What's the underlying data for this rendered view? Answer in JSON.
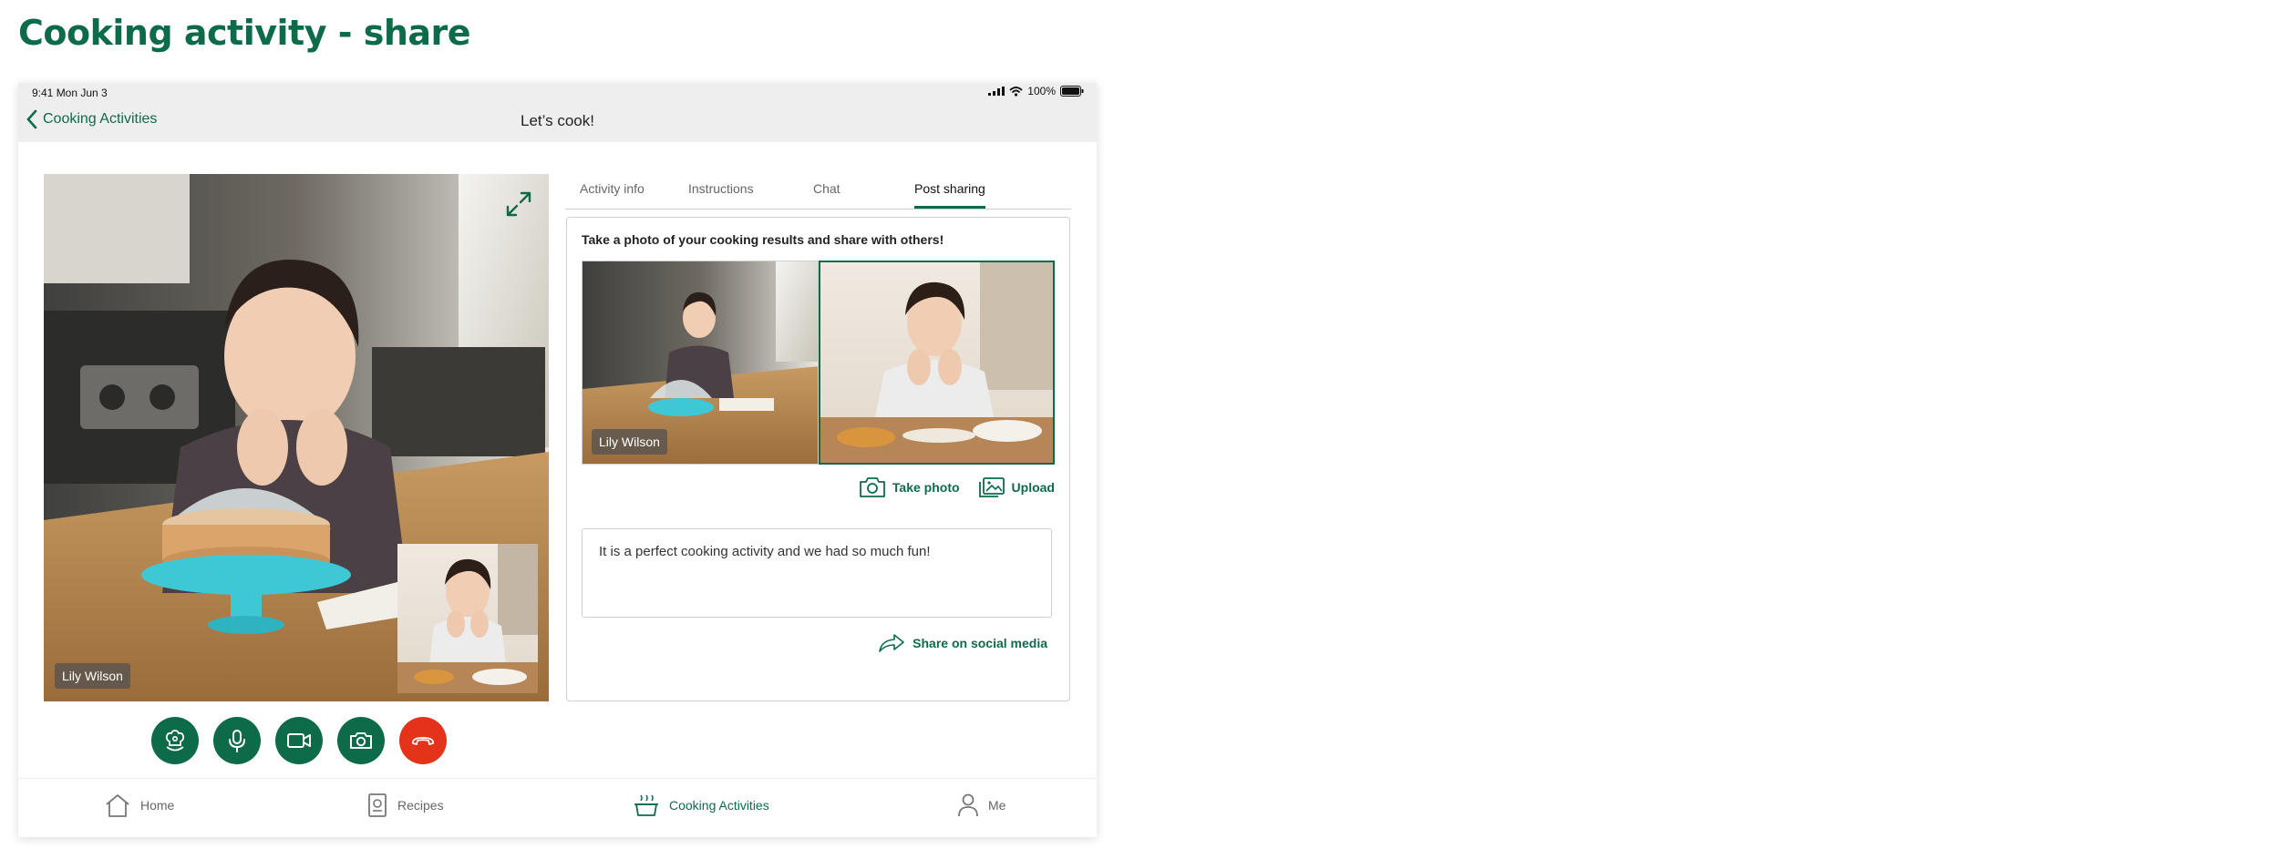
{
  "page": {
    "heading": "Cooking activity - share"
  },
  "status_bar": {
    "time": "9:41  Mon Jun 3",
    "battery": "100%"
  },
  "nav": {
    "back_label": "Cooking Activities",
    "title": "Let’s cook!"
  },
  "video": {
    "main_participant": "Lily Wilson"
  },
  "controls": [
    {
      "name": "ai-chef-button",
      "icon": "chef-hat-icon"
    },
    {
      "name": "microphone-button",
      "icon": "microphone-icon"
    },
    {
      "name": "video-camera-button",
      "icon": "video-camera-icon"
    },
    {
      "name": "snapshot-button",
      "icon": "camera-icon"
    },
    {
      "name": "end-call-button",
      "icon": "hang-up-icon"
    }
  ],
  "tabs": [
    {
      "label": "Activity  info"
    },
    {
      "label": "Instructions"
    },
    {
      "label": "Chat"
    },
    {
      "label": "Post sharing",
      "active": true
    }
  ],
  "share": {
    "prompt": "Take a photo of your cooking results and share with others!",
    "photo_left_name": "Lily Wilson",
    "take_photo_label": "Take photo",
    "upload_label": "Upload",
    "comment": "It is a perfect cooking activity and we had so much fun!",
    "share_label": "Share on social media"
  },
  "bottom_nav": [
    {
      "label": "Home",
      "icon": "home-icon"
    },
    {
      "label": "Recipes",
      "icon": "recipes-icon"
    },
    {
      "label": "Cooking Activities",
      "icon": "cooking-pot-icon",
      "active": true
    },
    {
      "label": "Me",
      "icon": "person-icon"
    }
  ],
  "colors": {
    "brand": "#0d6b4a",
    "end_call": "#e4321b"
  }
}
